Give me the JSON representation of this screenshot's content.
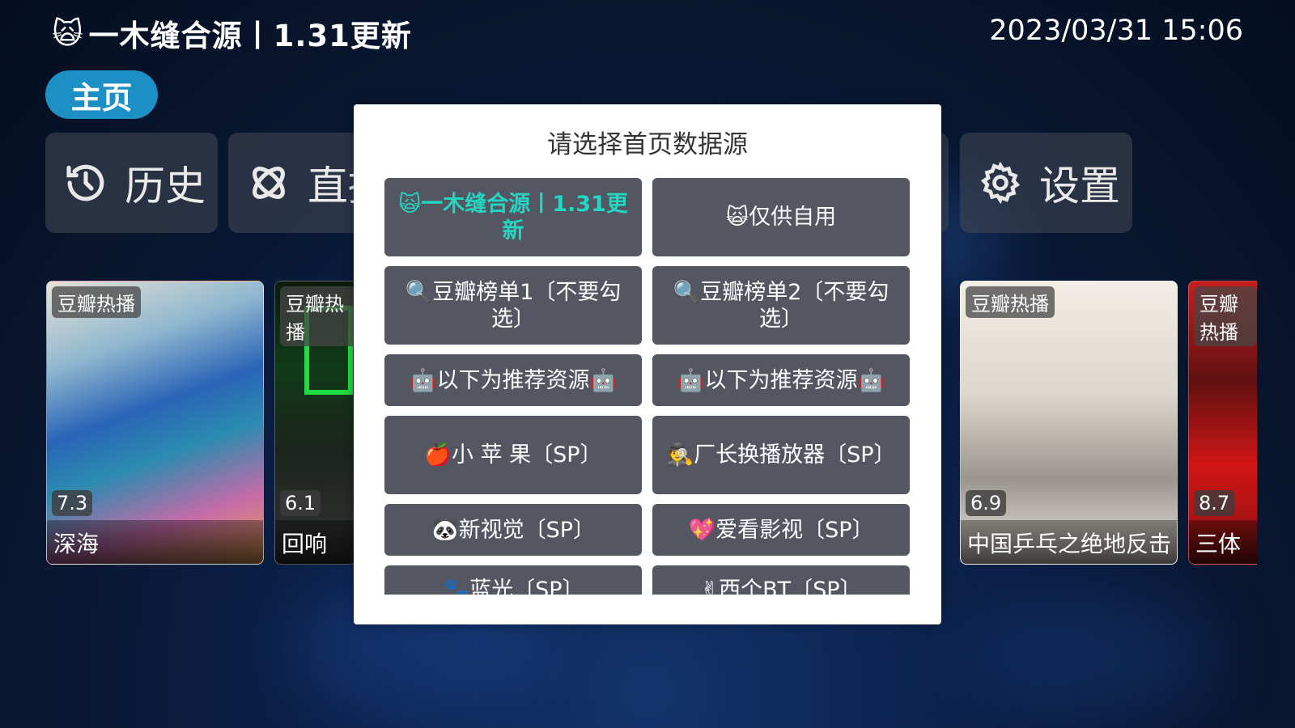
{
  "header": {
    "logo_emoji": "🙀",
    "title": "一木缝合源丨1.31更新",
    "clock": "2023/03/31 15:06"
  },
  "tabs": {
    "home": "主页"
  },
  "nav": [
    {
      "icon": "history-icon",
      "label": "历史"
    },
    {
      "icon": "live-icon",
      "label": "直播"
    },
    {
      "icon": "gear-icon",
      "label": "设置"
    }
  ],
  "movies": [
    {
      "badge": "豆瓣热播",
      "score": "7.3",
      "title": "深海"
    },
    {
      "badge": "豆瓣热播",
      "score": "6.1",
      "title": "回响"
    },
    {
      "badge": "豆瓣热播",
      "score": "6.9",
      "title": "中国乒乓之绝地反击"
    },
    {
      "badge": "豆瓣热播",
      "score": "8.7",
      "title": "三体"
    }
  ],
  "dialog": {
    "title": "请选择首页数据源",
    "options": [
      {
        "label": "🙀一木缝合源丨1.31更新",
        "selected": true
      },
      {
        "label": "🙀仅供自用"
      },
      {
        "label": "🔍豆瓣榜单1〔不要勾选〕"
      },
      {
        "label": "🔍豆瓣榜单2〔不要勾选〕"
      },
      {
        "label": "🤖以下为推荐资源🤖"
      },
      {
        "label": "🤖以下为推荐资源🤖"
      },
      {
        "label": "🍎小 苹 果〔SP〕"
      },
      {
        "label": "🕵厂长换播放器〔SP〕"
      },
      {
        "label": "🐼新视觉〔SP〕"
      },
      {
        "label": "💖爱看影视〔SP〕"
      },
      {
        "label": "🐾蓝光〔SP〕"
      },
      {
        "label": "✌西个BT〔SP〕"
      }
    ]
  },
  "colors": {
    "accent": "#1c8fc4",
    "selected_text": "#23d6c2",
    "option_bg": "#545762"
  }
}
